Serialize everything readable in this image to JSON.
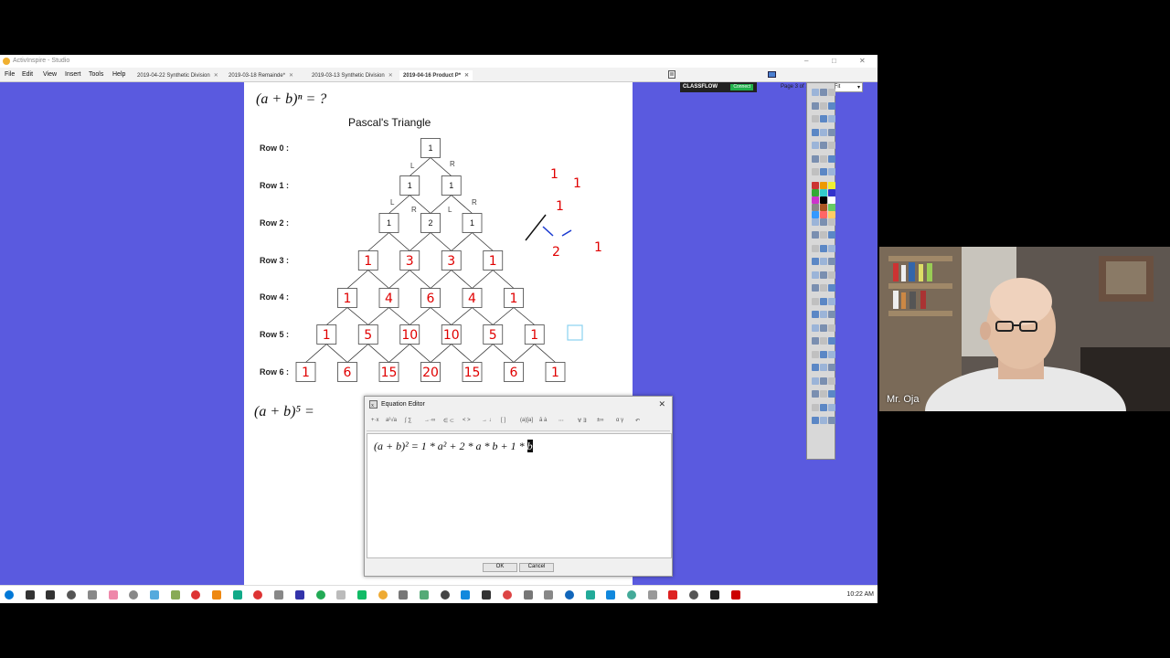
{
  "window": {
    "title": "ActivInspire - Studio",
    "min": "–",
    "max": "□",
    "close": "✕"
  },
  "menus": [
    "File",
    "Edit",
    "View",
    "Insert",
    "Tools",
    "Help"
  ],
  "doc_tabs": [
    {
      "label": "2019-04-22 Synthetic Division",
      "active": false
    },
    {
      "label": "2019-03-18 Remainde*",
      "active": false
    },
    {
      "label": "2019-03-13 Synthetic Division",
      "active": false
    },
    {
      "label": "2019-04-16 Product P*",
      "active": true
    }
  ],
  "classflow": {
    "label": "CLASSFLOW",
    "status": "Connect"
  },
  "page_indicator": "Page 3 of 10",
  "zoom": "Best Fit",
  "flipchart": {
    "formula_top": "(a + b)ⁿ = ?",
    "triangle_title": "Pascal's Triangle",
    "row_labels": [
      "Row 0 :",
      "Row 1 :",
      "Row 2 :",
      "Row 3 :",
      "Row 4 :",
      "Row 5 :",
      "Row 6 :"
    ],
    "rows_printed": [
      [
        "1"
      ],
      [
        "1",
        "1"
      ],
      [
        "1",
        "2",
        "1"
      ]
    ],
    "rows_handwritten": [
      [
        "1",
        "3",
        "3",
        "1"
      ],
      [
        "1",
        "4",
        "6",
        "4",
        "1"
      ],
      [
        "1",
        "5",
        "10",
        "10",
        "5",
        "1"
      ],
      [
        "1",
        "6",
        "15",
        "20",
        "15",
        "6",
        "1"
      ]
    ],
    "path_labels": {
      "L": "L",
      "R": "R"
    },
    "sketch_digits": [
      "1",
      "1",
      "1",
      "1",
      "2"
    ],
    "formula_bottom": "(a + b)⁵ ="
  },
  "equation_editor": {
    "title": "Equation Editor",
    "close": "✕",
    "toolbar": [
      "+·x",
      "a²√a",
      "∫ ∑",
      "→·∞",
      "∈ ⊂",
      "< >",
      "→ ↓",
      "[ ]",
      "(a)[a]",
      "ā ȧ",
      "⋅⋅⋅",
      "∀ ∃",
      "±∞",
      "α γ",
      "↶"
    ],
    "expression": "(a + b)² = 1 * a² + 2 * a * b + 1 * ",
    "cursor_char": "b",
    "ok": "OK",
    "cancel": "Cancel"
  },
  "taskbar": {
    "clock": "10:22 AM"
  },
  "webcam": {
    "name": "Mr. Oja"
  },
  "colors": {
    "background": "#5a5adf",
    "handwriting": "#e00000",
    "classflow_connect": "#22b14c"
  }
}
